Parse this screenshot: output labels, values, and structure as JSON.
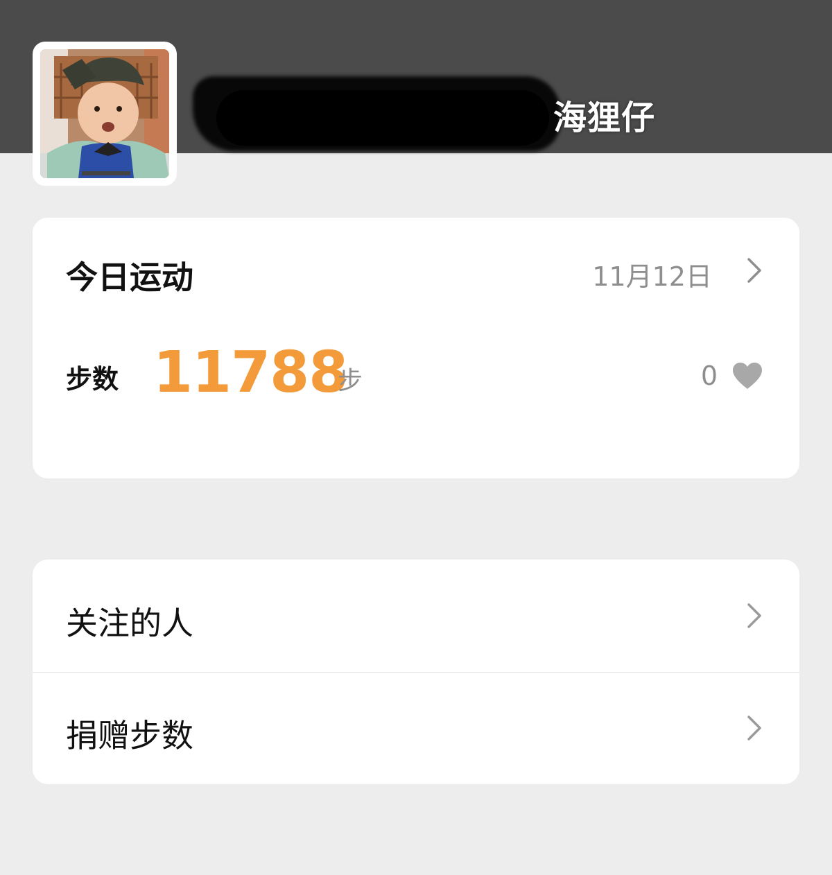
{
  "profile": {
    "username_visible": "海狸仔"
  },
  "today": {
    "title": "今日运动",
    "date": "11月12日",
    "steps_label": "步数",
    "steps_value": "11788",
    "steps_unit": "步",
    "like_count": "0"
  },
  "menu": {
    "items": [
      {
        "label": "关注的人"
      },
      {
        "label": "捐赠步数"
      }
    ]
  },
  "colors": {
    "banner": "#4b4b4b",
    "background": "#ededed",
    "steps_accent": "#f39b3a",
    "secondary_text": "#8e8e8e",
    "heart": "#a8a8a8"
  },
  "icons": {
    "chevron": "chevron-right-icon",
    "like": "heart-icon"
  }
}
